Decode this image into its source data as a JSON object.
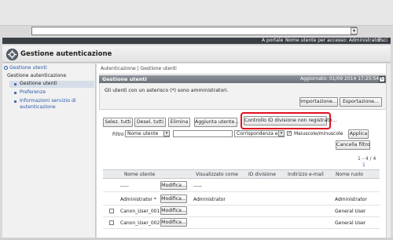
{
  "browser": {
    "address_dropdown_icon": "chevron-down-icon"
  },
  "topbar": {
    "portal_link": "A portale",
    "user_label": "Nome utente per accesso: Administrator",
    "logout": "Esci"
  },
  "header": {
    "title": "Gestione autenticazione",
    "icon": "gear-icon"
  },
  "sidebar": {
    "top_link": "Gestione utenti",
    "section": "Gestione autenticazione",
    "items": [
      {
        "label": "Gestione utenti",
        "selected": true
      },
      {
        "label": "Preferenze",
        "selected": false
      },
      {
        "label_line1": "Informazioni servizio di",
        "label_line2": "autenticazione",
        "selected": false
      }
    ]
  },
  "main": {
    "breadcrumb": "Autenticazione | Gestione utenti",
    "panel_title": "Gestione utenti",
    "updated": "Aggiornato: 01/09 2014 17:25:54",
    "refresh_icon": "refresh-icon",
    "note": "Gli utenti con un asterisco (*) sono amministratori.",
    "import_button": "Importazione...",
    "export_button": "Esportazione...",
    "toolbar": {
      "select_all": "Selez. tutti",
      "deselect_all": "Desel. tutti",
      "delete": "Elimina",
      "add_user": "Aggiunta utente...",
      "check_division": "Controllo ID divisione non registrato..."
    },
    "filter": {
      "label": "Filtro",
      "field_select": "Nome utente",
      "text_value": "",
      "match_select": "Corrispondenza esatta",
      "case_checked": true,
      "case_label": "Maiuscole/minuscole",
      "apply": "Applica",
      "cancel": "Cancella filtro"
    },
    "pager": {
      "range": "1 - 4 / 4",
      "page": "1"
    },
    "table": {
      "columns": [
        "Nome utente",
        "Visualizzato come",
        "ID divisione",
        "Indirizzo e-mail",
        "Nome ruolo"
      ],
      "modify_label": "Modifica...",
      "rows": [
        {
          "name": "-----",
          "display": "-----",
          "division": "",
          "email": "",
          "role": "",
          "checkbox": false
        },
        {
          "name": "Administrator *",
          "display": "Administrator",
          "division": "",
          "email": "",
          "role": "Administrator",
          "checkbox": false
        },
        {
          "name": "Canon_User_001",
          "display": "",
          "division": "",
          "email": "",
          "role": "General User",
          "checkbox": true
        },
        {
          "name": "Canon_User_002",
          "display": "",
          "division": "",
          "email": "",
          "role": "General User",
          "checkbox": true
        }
      ]
    }
  },
  "colors": {
    "accent_link": "#2a5aa8",
    "highlight": "#e0121f",
    "topbar": "#3b3f45",
    "panel_header": "#6c727a"
  }
}
